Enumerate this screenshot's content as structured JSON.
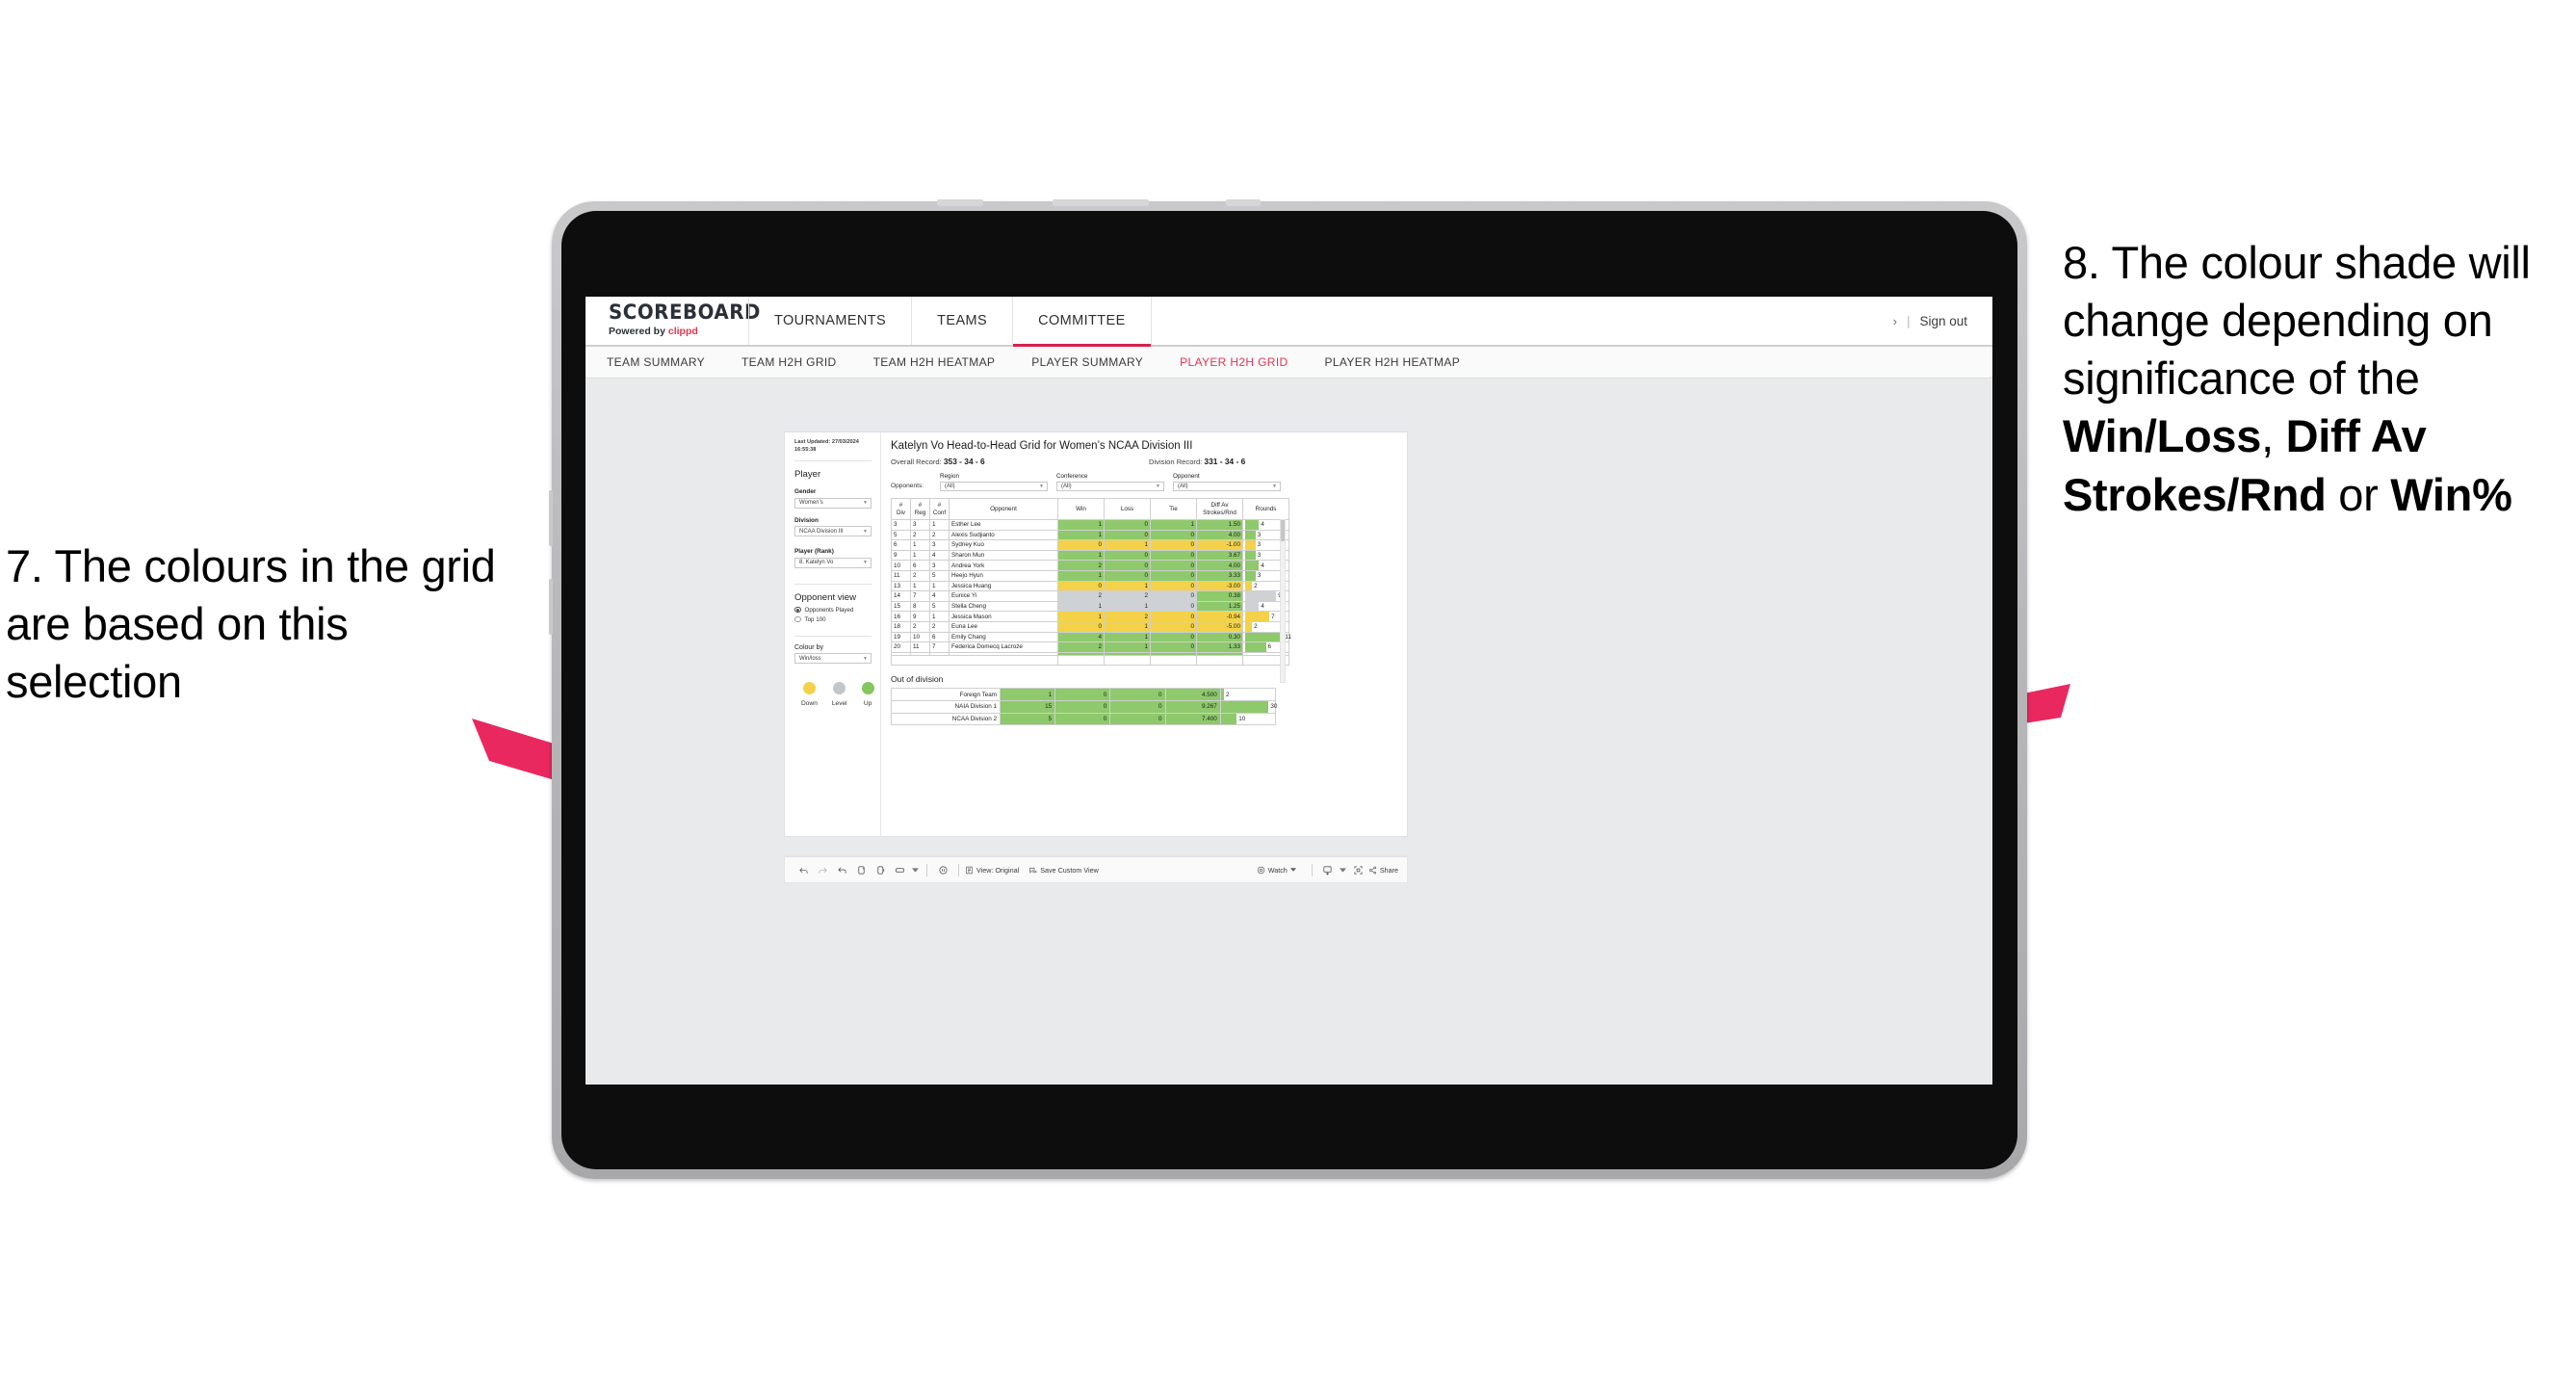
{
  "annotations": {
    "left": "7. The colours in the grid are based on this selection",
    "right_pre": "8. The colour shade will change depending on significance of the ",
    "right_b1": "Win/Loss",
    "right_mid1": ", ",
    "right_b2": "Diff Av Strokes/Rnd",
    "right_mid2": " or ",
    "right_b3": "Win%",
    "arrow_color": "#e8285f"
  },
  "app": {
    "brand_name": "SCOREBOARD",
    "brand_powered": "Powered by ",
    "brand_clippd": "clippd",
    "topnav": [
      {
        "label": "TOURNAMENTS",
        "active": false
      },
      {
        "label": "TEAMS",
        "active": false
      },
      {
        "label": "COMMITTEE",
        "active": true
      }
    ],
    "header_right": {
      "chevron": "›",
      "divider": "|",
      "sign_out": "Sign out"
    },
    "subnav": [
      {
        "label": "TEAM SUMMARY",
        "active": false
      },
      {
        "label": "TEAM H2H GRID",
        "active": false
      },
      {
        "label": "TEAM H2H HEATMAP",
        "active": false
      },
      {
        "label": "PLAYER SUMMARY",
        "active": false
      },
      {
        "label": "PLAYER H2H GRID",
        "active": true
      },
      {
        "label": "PLAYER H2H HEATMAP",
        "active": false
      }
    ]
  },
  "filters": {
    "last_updated": "Last Updated: 27/03/2024 16:55:38",
    "player_heading": "Player",
    "gender": {
      "label": "Gender",
      "value": "Women’s"
    },
    "division": {
      "label": "Division",
      "value": "NCAA Division III"
    },
    "player_rank": {
      "label": "Player (Rank)",
      "value": "8. Katelyn Vo"
    },
    "opponent_view": {
      "heading": "Opponent view",
      "options": [
        {
          "label": "Opponents Played",
          "selected": true
        },
        {
          "label": "Top 100",
          "selected": false
        }
      ]
    },
    "colour_by": {
      "label": "Colour by",
      "value": "Win/loss"
    },
    "legend": [
      {
        "label": "Down",
        "color": "#f3d249"
      },
      {
        "label": "Level",
        "color": "#c2c6c9"
      },
      {
        "label": "Up",
        "color": "#83c75d"
      }
    ]
  },
  "main": {
    "title": "Katelyn Vo Head-to-Head Grid for Women’s NCAA Division III",
    "overall_record_label": "Overall Record: ",
    "overall_record_value": "353 -  34 - 6",
    "division_record_label": "Division Record: ",
    "division_record_value": "331 -  34 - 6",
    "opponents_label": "Opponents:",
    "opponent_filters": [
      {
        "label": "Region",
        "value": "(All)"
      },
      {
        "label": "Conference",
        "value": "(All)"
      },
      {
        "label": "Opponent",
        "value": "(All)"
      }
    ]
  },
  "chart_data": {
    "type": "table",
    "title": "Katelyn Vo Head-to-Head Grid for Women’s NCAA Division III",
    "columns": [
      "# Div",
      "# Reg",
      "# Conf",
      "Opponent",
      "Win",
      "Loss",
      "Tie",
      "Diff Av Strokes/Rnd",
      "Rounds"
    ],
    "rounds_max": 12,
    "rows": [
      {
        "div": "3",
        "reg": "3",
        "conf": "1",
        "opponent": "Esther Lee",
        "win": "1",
        "loss": "0",
        "tie": "1",
        "diff": "1.50",
        "rounds": "4",
        "color": "#8ec96b"
      },
      {
        "div": "5",
        "reg": "2",
        "conf": "2",
        "opponent": "Alexis Sudjianto",
        "win": "1",
        "loss": "0",
        "tie": "0",
        "diff": "4.00",
        "rounds": "3",
        "color": "#8ec96b"
      },
      {
        "div": "6",
        "reg": "1",
        "conf": "3",
        "opponent": "Sydney Kuo",
        "win": "0",
        "loss": "1",
        "tie": "0",
        "diff": "-1.00",
        "rounds": "3",
        "color": "#f3d249"
      },
      {
        "div": "9",
        "reg": "1",
        "conf": "4",
        "opponent": "Sharon Mun",
        "win": "1",
        "loss": "0",
        "tie": "0",
        "diff": "3.67",
        "rounds": "3",
        "color": "#8ec96b"
      },
      {
        "div": "10",
        "reg": "6",
        "conf": "3",
        "opponent": "Andrea York",
        "win": "2",
        "loss": "0",
        "tie": "0",
        "diff": "4.00",
        "rounds": "4",
        "color": "#8ec96b"
      },
      {
        "div": "11",
        "reg": "2",
        "conf": "5",
        "opponent": "Heejo Hyun",
        "win": "1",
        "loss": "0",
        "tie": "0",
        "diff": "3.33",
        "rounds": "3",
        "color": "#8ec96b"
      },
      {
        "div": "13",
        "reg": "1",
        "conf": "1",
        "opponent": "Jessica Huang",
        "win": "0",
        "loss": "1",
        "tie": "0",
        "diff": "-3.00",
        "rounds": "2",
        "color": "#f3d249"
      },
      {
        "div": "14",
        "reg": "7",
        "conf": "4",
        "opponent": "Eunice Yi",
        "win": "2",
        "loss": "2",
        "tie": "0",
        "diff": "0.38",
        "rounds": "9",
        "color": "#cfd2d4",
        "diff_color": "#8ec96b"
      },
      {
        "div": "15",
        "reg": "8",
        "conf": "5",
        "opponent": "Stella Cheng",
        "win": "1",
        "loss": "1",
        "tie": "0",
        "diff": "1.25",
        "rounds": "4",
        "color": "#cfd2d4",
        "diff_color": "#8ec96b"
      },
      {
        "div": "16",
        "reg": "9",
        "conf": "1",
        "opponent": "Jessica Mason",
        "win": "1",
        "loss": "2",
        "tie": "0",
        "diff": "-0.94",
        "rounds": "7",
        "color": "#f3d249"
      },
      {
        "div": "18",
        "reg": "2",
        "conf": "2",
        "opponent": "Euna Lee",
        "win": "0",
        "loss": "1",
        "tie": "0",
        "diff": "-5.00",
        "rounds": "2",
        "color": "#f3d249"
      },
      {
        "div": "19",
        "reg": "10",
        "conf": "6",
        "opponent": "Emily Chang",
        "win": "4",
        "loss": "1",
        "tie": "0",
        "diff": "0.30",
        "rounds": "11",
        "color": "#8ec96b"
      },
      {
        "div": "20",
        "reg": "11",
        "conf": "7",
        "opponent": "Federica Domecq Lacroze",
        "win": "2",
        "loss": "1",
        "tie": "0",
        "diff": "1.33",
        "rounds": "6",
        "color": "#8ec96b"
      }
    ],
    "out_of_division_title": "Out of division",
    "out_of_division": [
      {
        "name": "Foreign Team",
        "win": "1",
        "loss": "0",
        "tie": "0",
        "diff": "4.500",
        "rounds": "2",
        "color": "#8ec96b"
      },
      {
        "name": "NAIA Division 1",
        "win": "15",
        "loss": "0",
        "tie": "0",
        "diff": "9.267",
        "rounds": "30",
        "color": "#8ec96b"
      },
      {
        "name": "NCAA Division 2",
        "win": "5",
        "loss": "0",
        "tie": "0",
        "diff": "7.400",
        "rounds": "10",
        "color": "#8ec96b"
      }
    ],
    "ood_rounds_max": 34
  },
  "toolbar": {
    "view_label": "View: Original",
    "save_label": "Save Custom View",
    "watch_label": "Watch",
    "share_label": "Share"
  }
}
